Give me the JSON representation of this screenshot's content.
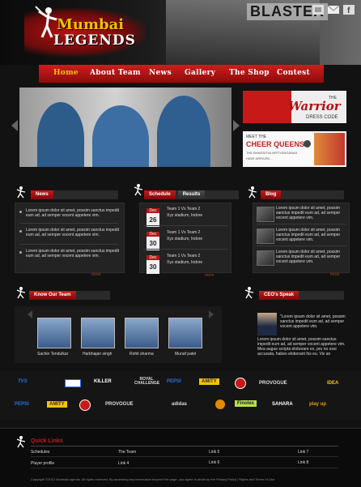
{
  "header": {
    "logo_line1": "Mumbai",
    "logo_line2": "LEGENDS",
    "banner_text": "BLASTER",
    "social_icons": [
      "rss-icon",
      "mail-icon",
      "facebook-icon"
    ]
  },
  "nav": {
    "items": [
      {
        "label": "Home",
        "active": true
      },
      {
        "label": "About Team"
      },
      {
        "label": "News"
      },
      {
        "label": "Gallery"
      },
      {
        "label": "The Shop"
      },
      {
        "label": "Contest"
      }
    ]
  },
  "promos": {
    "warrior": {
      "line1": "THE",
      "line2": "Warrior",
      "line3": "DRESS CODE"
    },
    "cheer": {
      "line1": "MEET THE",
      "line2": "CHEER QUEENS",
      "line3": "THE BHARATIYA NRITYANGANAS",
      "line4": "HAVE ARRIVED..."
    }
  },
  "news": {
    "title": "News",
    "items": [
      "Lorem ipsum dolor sit amet, possim sanctus impedit eum ad, ad semper vocent appetere vim.",
      "Lorem ipsum dolor sit amet, possim sanctus impedit eum ad, ad semper vocent appetere vim.",
      "Lorem ipsum dolor sit amet, possim sanctus impedit eum ad, ad semper vocent appetere vim."
    ],
    "more": "more"
  },
  "schedule": {
    "tabs": [
      "Schedule",
      "Results"
    ],
    "items": [
      {
        "month": "Dec",
        "day": "26",
        "teams": "Team 1 Vs Team 2",
        "venue": "Xyz stadium, Indore"
      },
      {
        "month": "Dec",
        "day": "30",
        "teams": "Team 1 Vs Team 2",
        "venue": "Xyz stadium, Indore"
      },
      {
        "month": "Dec",
        "day": "30",
        "teams": "Team 1 Vs Team 2",
        "venue": "Xyz stadium, Indore"
      }
    ],
    "more": "more"
  },
  "blog": {
    "title": "Blog",
    "items": [
      "Lorem ipsum dolor sit amet, possim sanctus impedit eum ad, ad semper vocent appetere vim.",
      "Lorem ipsum dolor sit amet, possim sanctus impedit eum ad, ad semper vocent appetere vim.",
      "Lorem ipsum dolor sit amet, possim sanctus impedit eum ad, ad semper vocent appetere vim."
    ],
    "more": "more"
  },
  "team": {
    "title": "Know Our Team",
    "members": [
      "Sachin Tendulkar",
      "Harbhajan singh",
      "Rohit sharma",
      "Munaf patel"
    ]
  },
  "ceo": {
    "title": "CEO's Speak",
    "quote": "\"Lorem ipsum dolor sit amet, possim sanctus impedit eum ad, ad semper vocent appetere vim.",
    "body": "Lorem ipsum dolor sit amet, possim sanctus impedit eum ad, ad semper vocent appetere vim. Mea augue scripta eloborare ex, pro no ossi accusata, habeo eloborant his eu. Vix an"
  },
  "sponsors": {
    "row1": [
      "TVS",
      "",
      "KILLER",
      "ROYAL CHALLENGE",
      "PEPSI",
      "AMITY",
      "",
      "PROVOGUE",
      "IDEA"
    ],
    "row2": [
      "PEPSI",
      "AMITY",
      "",
      "PROVOGUE",
      "adidas",
      "",
      "Finolex",
      "SAHARA",
      "play up"
    ]
  },
  "footer": {
    "title": "Quick Links",
    "col1": [
      "Schedules",
      "Player profile"
    ],
    "col2": [
      "The Team",
      "Link 4"
    ],
    "col3": [
      "Link 5",
      "Link 6"
    ],
    "col4": [
      "Link 7",
      "Link 8"
    ],
    "copyright": "Copyright ©2012 MumbaiLegends. All rights reserved. By accessing any information beyond this page, you agree to abide by the Privacy Policy | Rights and Terms of Use."
  }
}
